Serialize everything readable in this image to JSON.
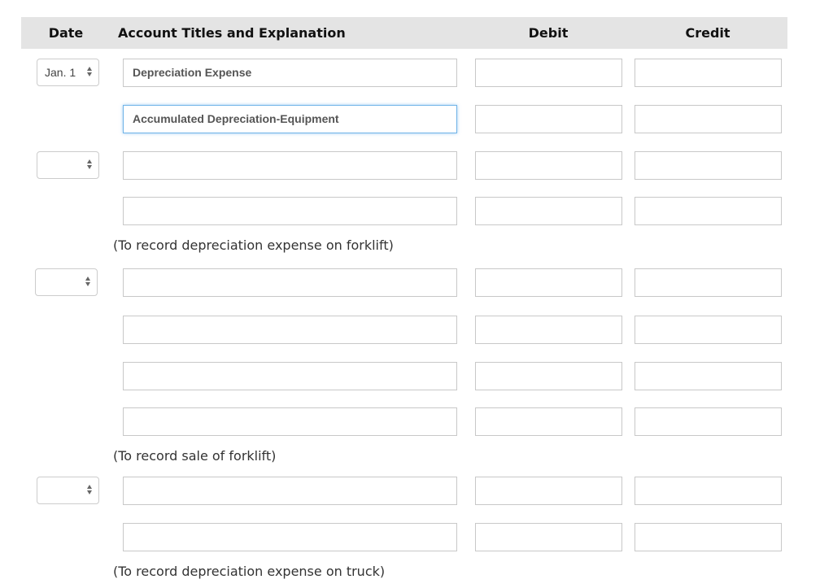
{
  "header": {
    "date": "Date",
    "account": "Account Titles and Explanation",
    "debit": "Debit",
    "credit": "Credit"
  },
  "entries": [
    {
      "date": "Jan. 1",
      "rows": [
        {
          "account": "Depreciation Expense",
          "debit": "",
          "credit": ""
        },
        {
          "account": "Accumulated Depreciation-Equipment",
          "debit": "",
          "credit": ""
        }
      ]
    },
    {
      "date": "",
      "rows": [
        {
          "account": "",
          "debit": "",
          "credit": ""
        },
        {
          "account": "",
          "debit": "",
          "credit": ""
        }
      ],
      "note": "(To record depreciation expense on forklift)"
    },
    {
      "date": "",
      "rows": [
        {
          "account": "",
          "debit": "",
          "credit": ""
        },
        {
          "account": "",
          "debit": "",
          "credit": ""
        },
        {
          "account": "",
          "debit": "",
          "credit": ""
        },
        {
          "account": "",
          "debit": "",
          "credit": ""
        }
      ],
      "note": "(To record sale of forklift)"
    },
    {
      "date": "",
      "rows": [
        {
          "account": "",
          "debit": "",
          "credit": ""
        },
        {
          "account": "",
          "debit": "",
          "credit": ""
        }
      ],
      "note": "(To record depreciation expense on truck)"
    }
  ]
}
